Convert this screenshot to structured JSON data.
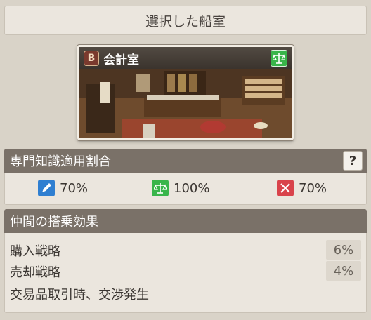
{
  "header": {
    "title": "選択した船室"
  },
  "room": {
    "rank_badge": "B",
    "name": "会計室",
    "icon": "scale-icon",
    "icon_color": "#38b54a"
  },
  "expertise": {
    "title": "専門知識適用割合",
    "help_label": "?",
    "ratios": [
      {
        "icon": "pen-icon",
        "color": "#2f7fd1",
        "value": "70%"
      },
      {
        "icon": "scale-icon",
        "color": "#38b54a",
        "value": "100%"
      },
      {
        "icon": "swords-icon",
        "color": "#d9434b",
        "value": "70%"
      }
    ]
  },
  "crew_effect": {
    "title": "仲間の搭乗効果",
    "rows": [
      {
        "label": "購入戦略",
        "value": "6%"
      },
      {
        "label": "売却戦略",
        "value": "4%"
      },
      {
        "label": "交易品取引時、交渉発生",
        "value": ""
      }
    ]
  }
}
